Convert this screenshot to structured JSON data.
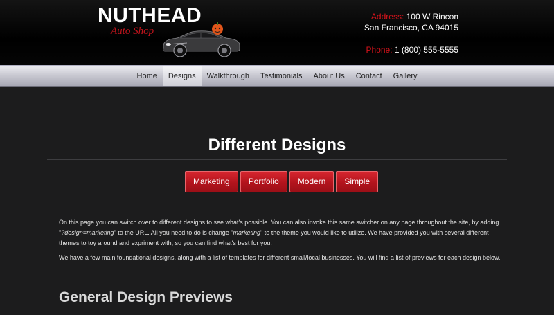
{
  "header": {
    "logo_title": "NUTHEAD",
    "logo_subtitle": "Auto Shop",
    "address_label": "Address:",
    "address_line1": "100 W Rincon",
    "address_line2": "San Francisco, CA 94015",
    "phone_label": "Phone:",
    "phone_value": "1 (800) 555-5555"
  },
  "nav": {
    "items": [
      {
        "label": "Home",
        "active": false
      },
      {
        "label": "Designs",
        "active": true
      },
      {
        "label": "Walkthrough",
        "active": false
      },
      {
        "label": "Testimonials",
        "active": false
      },
      {
        "label": "About Us",
        "active": false
      },
      {
        "label": "Contact",
        "active": false
      },
      {
        "label": "Gallery",
        "active": false
      }
    ]
  },
  "main": {
    "title": "Different Designs",
    "buttons": [
      {
        "label": "Marketing"
      },
      {
        "label": "Portfolio"
      },
      {
        "label": "Modern"
      },
      {
        "label": "Simple"
      }
    ],
    "paragraph1": {
      "part1": "On this page you can switch over to different designs to see what's possible. You can also invoke this same switcher on any page throughout the site, by adding \"",
      "code1": "?design=marketing",
      "part2": "\" to the URL. All you need to do is change \"",
      "code2": "marketing",
      "part3": "\" to the theme you would like to utilize. We have provided you with several different themes to toy around and expriment with, so you can find what's best for you."
    },
    "paragraph2": "We have a few main foundational designs, along with a list of templates for different small/local businesses. You will find a list of previews for each design below.",
    "section_title": "General Design Previews"
  },
  "colors": {
    "accent_red": "#d4131b",
    "page_background": "#1c1c1d",
    "nav_background": "#c9c9d2"
  }
}
